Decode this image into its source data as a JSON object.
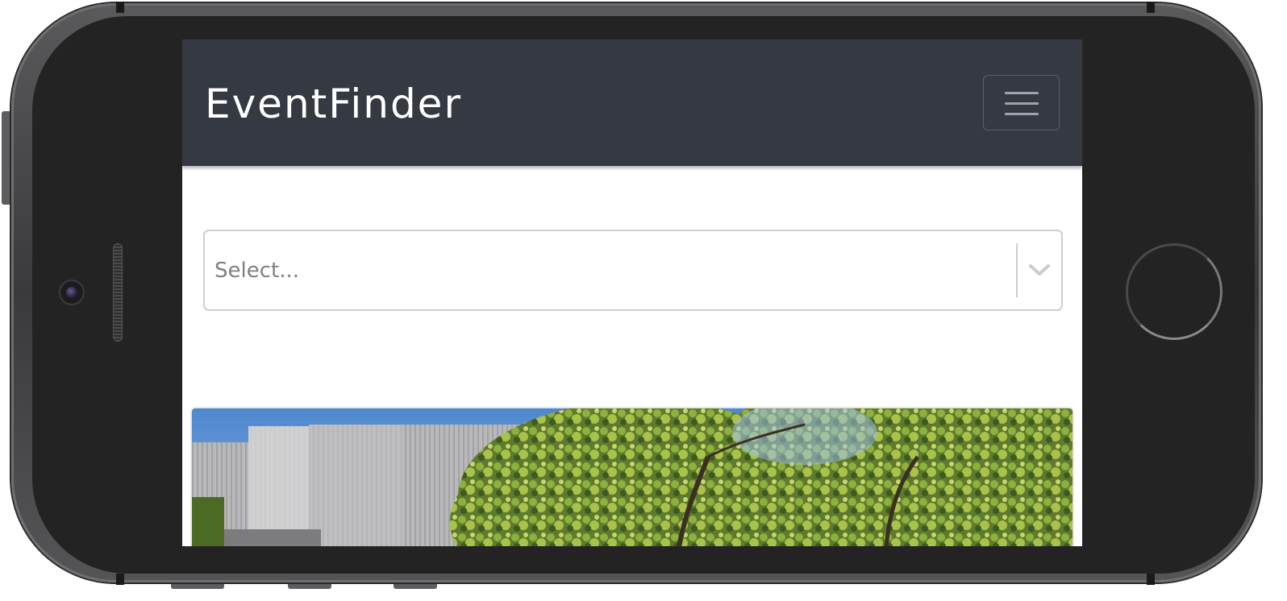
{
  "navbar": {
    "brand": "EventFinder",
    "menu_icon": "hamburger-menu-icon"
  },
  "select": {
    "placeholder": "Select...",
    "indicator_icon": "chevron-down-icon"
  },
  "card": {
    "image_icon": "event-venue-photo"
  },
  "colors": {
    "navbar_bg": "#353a42",
    "brand_text": "#ffffff",
    "select_border": "#cfcfcf",
    "placeholder_text": "#808080"
  }
}
